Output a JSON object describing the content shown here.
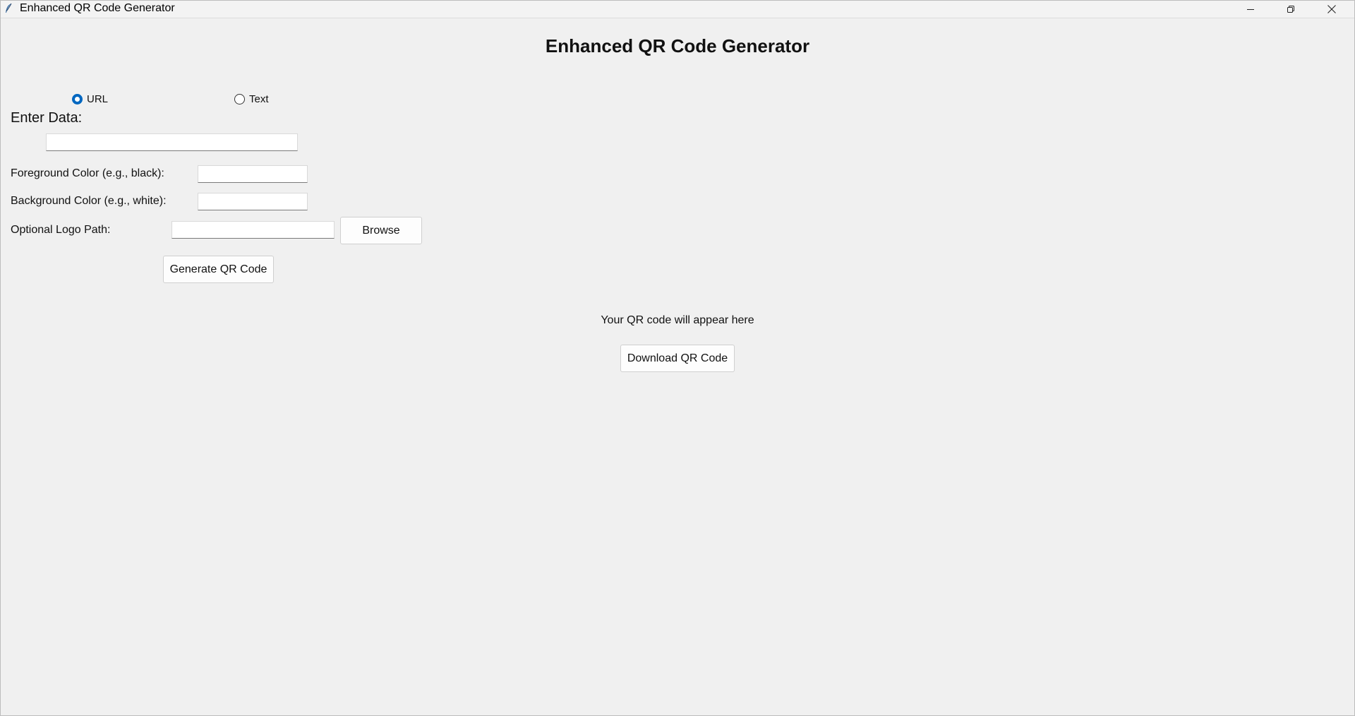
{
  "window": {
    "title": "Enhanced QR Code Generator"
  },
  "app": {
    "heading": "Enhanced QR Code Generator",
    "data_type": {
      "options": [
        {
          "label": "URL",
          "selected": true
        },
        {
          "label": "Text",
          "selected": false
        }
      ]
    },
    "enter_data_label": "Enter Data:",
    "enter_data_value": "",
    "foreground_label": "Foreground Color (e.g., black):",
    "foreground_value": "",
    "background_label": "Background Color (e.g., white):",
    "background_value": "",
    "logo_label": "Optional Logo Path:",
    "logo_value": "",
    "browse_label": "Browse",
    "generate_label": "Generate QR Code",
    "qr_placeholder": "Your QR code will appear here",
    "download_label": "Download QR Code"
  },
  "colors": {
    "accent": "#0067c0",
    "background": "#f0f0f0"
  },
  "icons": {
    "app": "feather-icon",
    "minimize": "minimize-icon",
    "restore": "restore-icon",
    "close": "close-icon"
  }
}
